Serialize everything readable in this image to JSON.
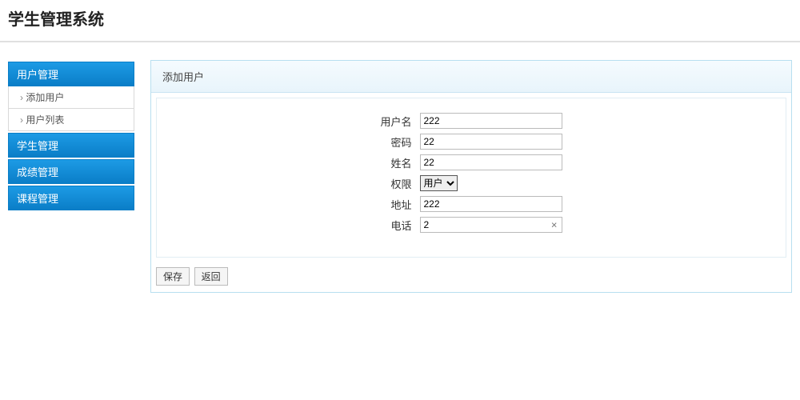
{
  "header": {
    "title": "学生管理系统"
  },
  "sidebar": {
    "sections": [
      {
        "label": "用户管理",
        "items": [
          "添加用户",
          "用户列表"
        ]
      },
      {
        "label": "学生管理",
        "items": []
      },
      {
        "label": "成绩管理",
        "items": []
      },
      {
        "label": "课程管理",
        "items": []
      }
    ]
  },
  "panel": {
    "title": "添加用户",
    "fields": {
      "username_label": "用户名",
      "username_value": "222",
      "password_label": "密码",
      "password_value": "22",
      "name_label": "姓名",
      "name_value": "22",
      "role_label": "权限",
      "role_selected": "用户",
      "address_label": "地址",
      "address_value": "222",
      "phone_label": "电话",
      "phone_value": "2"
    },
    "buttons": {
      "save": "保存",
      "back": "返回"
    }
  }
}
